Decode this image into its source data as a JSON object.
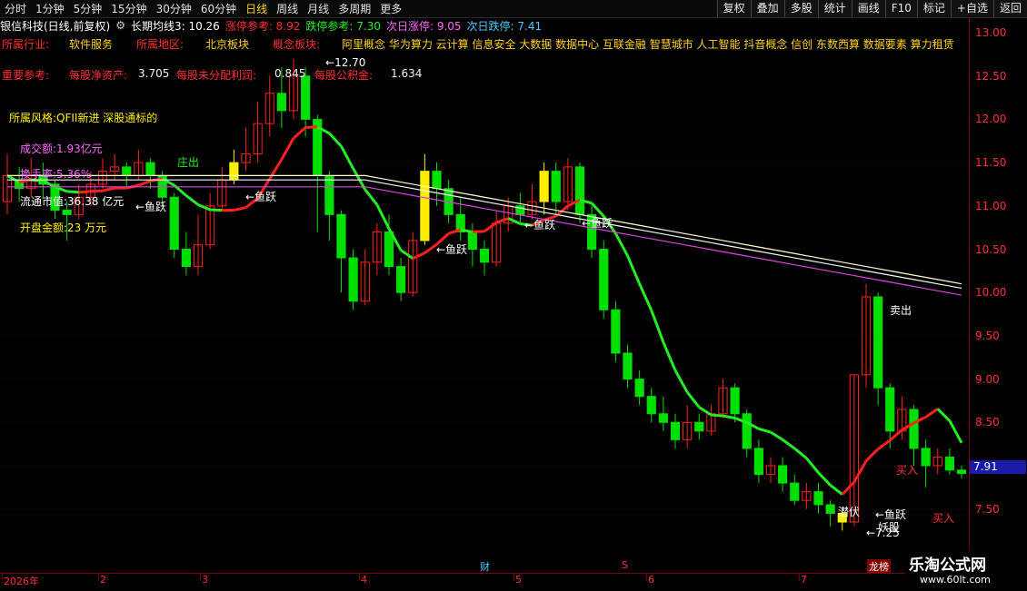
{
  "periods": [
    "分时",
    "1分钟",
    "5分钟",
    "15分钟",
    "30分钟",
    "60分钟",
    "日线",
    "周线",
    "月线",
    "多周期",
    "更多"
  ],
  "active_period": "日线",
  "toolbar": [
    "复权",
    "叠加",
    "多股",
    "统计",
    "画线",
    "F10",
    "标记",
    "+自选",
    "返回"
  ],
  "title": {
    "name": "银信科技(日线,前复权)",
    "ma": "长期均线3: 10.26",
    "rise_ref": "涨停参考: 8.92",
    "fall_ref": "跌停参考: 7.30",
    "next_rise": "次日涨停: 9.05",
    "next_fall": "次日跌停: 7.41"
  },
  "info": {
    "industry_label": "所属行业:",
    "industry": "软件服务",
    "region_label": "所属地区:",
    "region": "北京板块",
    "concept_label": "概念板块:",
    "concepts": "阿里概念 华为算力 云计算 信息安全 大数据 数据中心 互联金融 智慧城市 人工智能 抖音概念 信创 东数西算 数据要素 算力租赁",
    "ref_label": "重要参考:",
    "nav_label": "每股净资产:",
    "nav": "3.705",
    "undist_label": "每股未分配利润:",
    "undist": "0.845",
    "reserve_label": "每股公积金:",
    "reserve": "1.634",
    "style": "所属风格:QFII新进 深股通标的",
    "turnover_amount": "成交额:1.93亿元",
    "turnover_rate": "换手率:5.36%",
    "float_cap": "流通市值:36.38 亿元",
    "open_amount": "开盘金额:23 万元"
  },
  "price_axis": [
    "13.00",
    "12.50",
    "12.00",
    "11.50",
    "11.00",
    "10.50",
    "10.00",
    "9.50",
    "9.00",
    "8.50",
    "8.00",
    "7.50"
  ],
  "current_price": "7.91",
  "date_axis": [
    "2026年",
    "2",
    "3",
    "4",
    "5",
    "6",
    "7"
  ],
  "markers": {
    "finance": "财",
    "s": "S",
    "ranking": "龙榜"
  },
  "annotations": {
    "high": "12.70",
    "low": "7.25",
    "yuyue": "←鱼跃",
    "zhuangchu": "庄出",
    "maichu": "卖出",
    "mairu": "买入",
    "qianfu": "潜伏",
    "yaogu": "妖股"
  },
  "watermark": {
    "cn": "乐淘公式网",
    "url": "www.60lt.com"
  },
  "colors": {
    "up": "#ff2020",
    "down": "#00e000",
    "gold": "#ffee00",
    "ma_green": "#22ee22"
  },
  "chart_data": {
    "type": "candlestick",
    "ylim": [
      7.15,
      13.1
    ],
    "candles": [
      [
        11.05,
        11.35,
        11.6,
        10.9
      ],
      [
        11.3,
        11.2,
        11.45,
        11.05
      ],
      [
        11.2,
        11.35,
        11.55,
        11.1
      ],
      [
        11.35,
        11.25,
        11.5,
        11.1
      ],
      [
        11.25,
        10.95,
        11.3,
        10.85
      ],
      [
        10.95,
        10.9,
        11.05,
        10.6
      ],
      [
        10.9,
        11.1,
        11.25,
        10.85
      ],
      [
        11.1,
        11.25,
        11.4,
        11.0
      ],
      [
        11.25,
        11.4,
        11.55,
        11.2
      ],
      [
        11.4,
        11.45,
        11.6,
        11.3
      ],
      [
        11.45,
        11.35,
        11.5,
        11.2
      ],
      [
        11.35,
        11.5,
        11.65,
        11.3
      ],
      [
        11.5,
        11.35,
        11.55,
        11.2
      ],
      [
        11.35,
        11.1,
        11.4,
        11.0
      ],
      [
        11.1,
        10.5,
        11.15,
        10.4
      ],
      [
        10.5,
        10.3,
        10.7,
        10.2
      ],
      [
        10.3,
        10.55,
        10.9,
        10.2
      ],
      [
        10.55,
        11.0,
        11.15,
        10.5
      ],
      [
        11.0,
        11.3,
        11.45,
        10.95
      ],
      [
        11.3,
        11.5,
        11.65,
        11.25
      ],
      [
        11.5,
        11.6,
        11.9,
        11.4
      ],
      [
        11.6,
        11.95,
        12.2,
        11.5
      ],
      [
        11.95,
        12.3,
        12.5,
        11.8
      ],
      [
        12.3,
        12.1,
        12.6,
        11.9
      ],
      [
        12.1,
        12.5,
        12.7,
        12.0
      ],
      [
        12.5,
        12.0,
        12.6,
        11.8
      ],
      [
        12.0,
        11.35,
        12.05,
        10.7
      ],
      [
        11.35,
        10.9,
        11.4,
        10.6
      ],
      [
        10.9,
        10.4,
        10.95,
        10.0
      ],
      [
        10.4,
        9.9,
        10.5,
        9.8
      ],
      [
        9.9,
        10.35,
        10.5,
        9.85
      ],
      [
        10.35,
        10.7,
        10.8,
        10.2
      ],
      [
        10.7,
        10.3,
        10.9,
        10.2
      ],
      [
        10.3,
        10.0,
        10.4,
        9.9
      ],
      [
        10.0,
        10.6,
        10.7,
        9.95
      ],
      [
        10.6,
        11.4,
        11.6,
        10.55
      ],
      [
        11.4,
        11.2,
        11.5,
        11.0
      ],
      [
        11.2,
        10.9,
        11.3,
        10.8
      ],
      [
        10.9,
        10.7,
        11.1,
        10.6
      ],
      [
        10.7,
        10.5,
        10.8,
        10.3
      ],
      [
        10.5,
        10.35,
        10.6,
        10.2
      ],
      [
        10.35,
        10.8,
        10.95,
        10.3
      ],
      [
        10.8,
        11.0,
        11.1,
        10.7
      ],
      [
        11.0,
        10.9,
        11.15,
        10.8
      ],
      [
        10.9,
        11.05,
        11.25,
        10.85
      ],
      [
        11.05,
        11.4,
        11.5,
        10.9
      ],
      [
        11.4,
        11.05,
        11.5,
        10.9
      ],
      [
        11.05,
        11.45,
        11.55,
        10.95
      ],
      [
        11.45,
        10.9,
        11.5,
        10.8
      ],
      [
        10.9,
        10.5,
        11.0,
        10.4
      ],
      [
        10.5,
        9.8,
        10.6,
        9.7
      ],
      [
        9.8,
        9.3,
        9.9,
        9.2
      ],
      [
        9.3,
        9.0,
        9.4,
        8.9
      ],
      [
        9.0,
        8.8,
        9.1,
        8.7
      ],
      [
        8.8,
        8.6,
        8.9,
        8.5
      ],
      [
        8.6,
        8.5,
        8.8,
        8.4
      ],
      [
        8.5,
        8.3,
        8.6,
        8.2
      ],
      [
        8.3,
        8.5,
        8.7,
        8.2
      ],
      [
        8.5,
        8.4,
        8.6,
        8.3
      ],
      [
        8.4,
        8.6,
        8.7,
        8.35
      ],
      [
        8.6,
        8.9,
        9.0,
        8.55
      ],
      [
        8.9,
        8.6,
        8.95,
        8.5
      ],
      [
        8.6,
        8.2,
        8.65,
        8.1
      ],
      [
        8.2,
        7.9,
        8.3,
        7.8
      ],
      [
        7.9,
        8.0,
        8.1,
        7.8
      ],
      [
        8.0,
        7.8,
        8.1,
        7.7
      ],
      [
        7.8,
        7.6,
        7.9,
        7.55
      ],
      [
        7.6,
        7.7,
        7.8,
        7.5
      ],
      [
        7.7,
        7.55,
        7.8,
        7.45
      ],
      [
        7.55,
        7.45,
        7.6,
        7.3
      ],
      [
        7.45,
        7.35,
        7.5,
        7.25
      ],
      [
        7.35,
        9.05,
        9.05,
        7.3
      ],
      [
        9.05,
        9.95,
        10.1,
        8.9
      ],
      [
        9.95,
        8.9,
        10.0,
        8.7
      ],
      [
        8.9,
        8.4,
        8.95,
        8.2
      ],
      [
        8.4,
        8.65,
        8.8,
        8.3
      ],
      [
        8.65,
        8.2,
        8.7,
        8.0
      ],
      [
        8.2,
        8.0,
        8.3,
        7.75
      ],
      [
        8.0,
        8.1,
        8.2,
        7.9
      ],
      [
        8.1,
        7.95,
        8.2,
        7.9
      ],
      [
        7.95,
        7.91,
        8.0,
        7.85
      ]
    ]
  }
}
